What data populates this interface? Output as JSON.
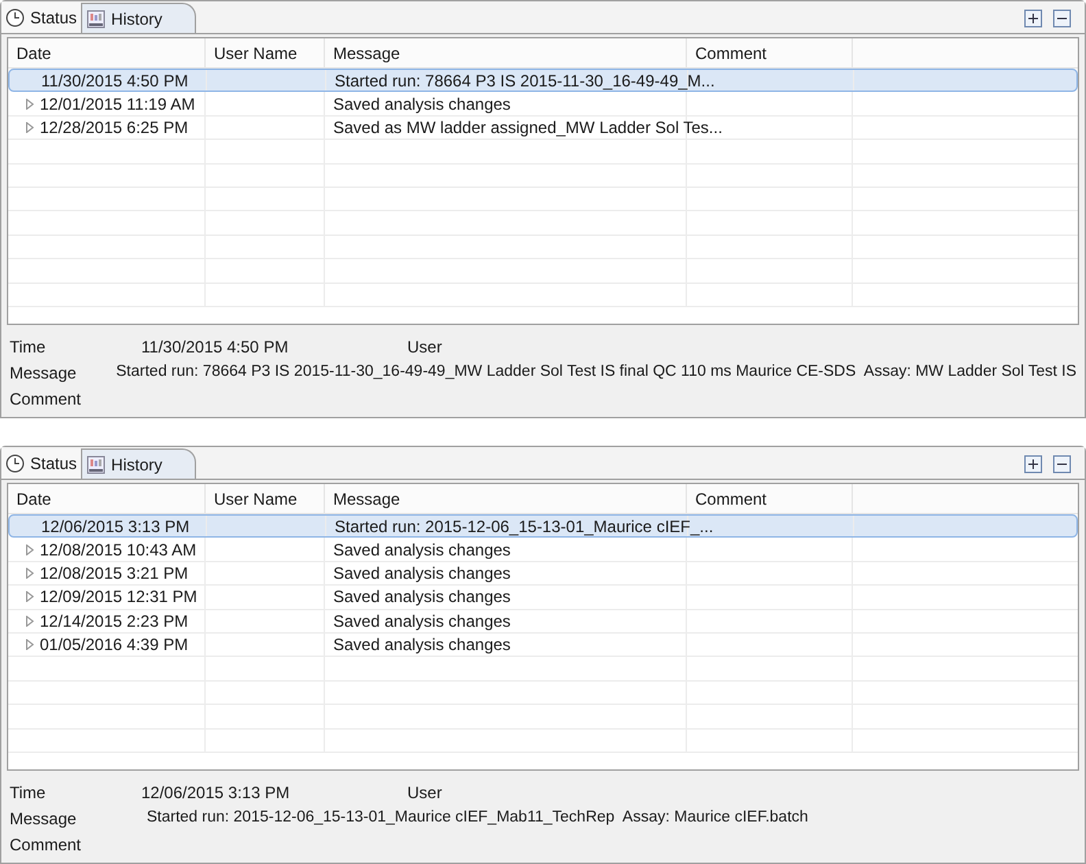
{
  "panels": [
    {
      "tabs": [
        {
          "label": "Status",
          "kind": "clock",
          "selected": false
        },
        {
          "label": "History",
          "kind": "history",
          "selected": true
        }
      ],
      "columns": [
        "Date",
        "User Name",
        "Message",
        "Comment"
      ],
      "rows": [
        {
          "date": "11/30/2015 4:50 PM",
          "message": "Started run: 78664 P3 IS 2015-11-30_16-49-49_M...",
          "selected": true,
          "expandable": false
        },
        {
          "date": "12/01/2015 11:19 AM",
          "message": "Saved analysis changes",
          "selected": false,
          "expandable": true
        },
        {
          "date": "12/28/2015 6:25 PM",
          "message": "Saved as MW ladder assigned_MW Ladder Sol Tes...",
          "selected": false,
          "expandable": true
        }
      ],
      "details": {
        "time_label": "Time",
        "time": "11/30/2015 4:50 PM",
        "user_label": "User",
        "message_label": "Message",
        "message": "Started run: 78664 P3 IS 2015-11-30_16-49-49_MW Ladder Sol Test IS final QC 110 ms Maurice CE-SDS  Assay: MW Ladder Sol Test IS",
        "comment_label": "Comment"
      }
    },
    {
      "tabs": [
        {
          "label": "Status",
          "kind": "clock",
          "selected": false
        },
        {
          "label": "History",
          "kind": "history",
          "selected": true
        }
      ],
      "columns": [
        "Date",
        "User Name",
        "Message",
        "Comment"
      ],
      "rows": [
        {
          "date": "12/06/2015 3:13 PM",
          "message": "Started run: 2015-12-06_15-13-01_Maurice cIEF_...",
          "selected": true,
          "expandable": false
        },
        {
          "date": "12/08/2015 10:43 AM",
          "message": "Saved analysis changes",
          "selected": false,
          "expandable": true
        },
        {
          "date": "12/08/2015 3:21 PM",
          "message": "Saved analysis changes",
          "selected": false,
          "expandable": true
        },
        {
          "date": "12/09/2015 12:31 PM",
          "message": "Saved analysis changes",
          "selected": false,
          "expandable": true
        },
        {
          "date": "12/14/2015 2:23 PM",
          "message": "Saved analysis changes",
          "selected": false,
          "expandable": true
        },
        {
          "date": "01/05/2016 4:39 PM",
          "message": "Saved analysis changes",
          "selected": false,
          "expandable": true
        }
      ],
      "details": {
        "time_label": "Time",
        "time": "12/06/2015 3:13 PM",
        "user_label": "User",
        "message_label": "Message",
        "message": "Started run: 2015-12-06_15-13-01_Maurice cIEF_Mab11_TechRep  Assay: Maurice cIEF.batch",
        "comment_label": "Comment"
      }
    }
  ]
}
